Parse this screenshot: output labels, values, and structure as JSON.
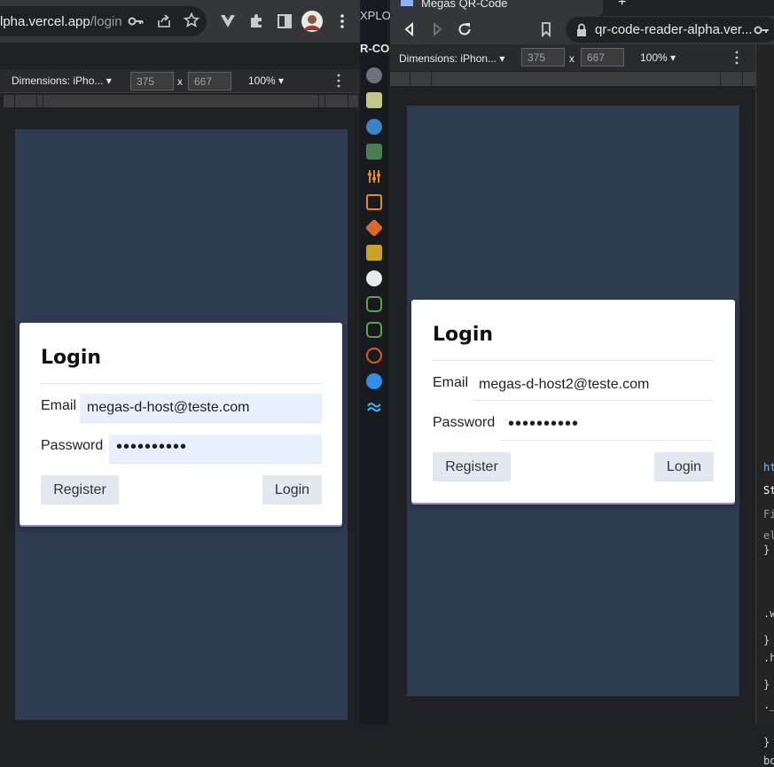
{
  "left_browser": {
    "url_host": "lpha.vercel.app",
    "url_path": "/login",
    "dimensions_label": "Dimensions: iPho...",
    "width_value": "375",
    "times": "x",
    "height_value": "667",
    "zoom": "100%",
    "login_card": {
      "title": "Login",
      "email_label": "Email",
      "email_value": "megas-d-host@teste.com",
      "password_label": "Password",
      "password_value": "••••••••••",
      "register_button": "Register",
      "login_button": "Login"
    }
  },
  "editor_strip": {
    "explorer_label": "XPLOR",
    "project_label": "R-CO"
  },
  "right_browser": {
    "tab_title": "Megas QR-Code",
    "url": "qr-code-reader-alpha.ver...",
    "dimensions_label": "Dimensions: iPhon...",
    "width_value": "375",
    "times": "x",
    "height_value": "667",
    "zoom": "100%",
    "login_card": {
      "title": "Login",
      "email_label": "Email",
      "email_value": "megas-d-host2@teste.com",
      "password_label": "Password",
      "password_value": "••••••••••",
      "register_button": "Register",
      "login_button": "Login"
    }
  },
  "devtools_edge": {
    "lines": [
      "ht",
      "St",
      "Fi",
      "el",
      "}",
      ".w",
      "}",
      ".h",
      "}",
      "._",
      "}",
      "bo"
    ]
  },
  "colors": {
    "page_bg": "#2e3b51",
    "card_bg": "#ffffff",
    "autofill_bg": "#e8f0fe",
    "button_bg": "#e2e8f0"
  }
}
